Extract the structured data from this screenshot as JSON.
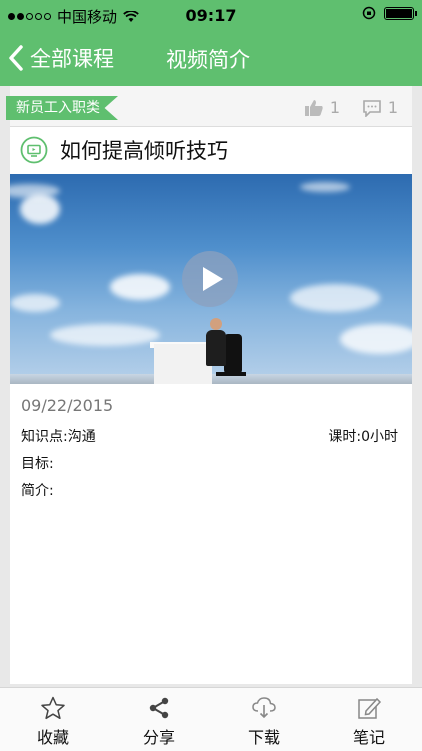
{
  "status_bar": {
    "carrier": "中国移动",
    "time": "09:17"
  },
  "nav": {
    "back_label": "全部课程",
    "title": "视频简介"
  },
  "course": {
    "category_tag": "新员工入职类",
    "like_count": "1",
    "comment_count": "1",
    "title": "如何提高倾听技巧",
    "date": "09/22/2015",
    "knowledge_point": "知识点:沟通",
    "hours": "课时:0小时",
    "goal": "目标:",
    "intro": "简介:"
  },
  "tabs": [
    {
      "label": "收藏",
      "icon": "star-icon"
    },
    {
      "label": "分享",
      "icon": "share-icon"
    },
    {
      "label": "下载",
      "icon": "cloud-download-icon"
    },
    {
      "label": "笔记",
      "icon": "note-edit-icon"
    }
  ],
  "colors": {
    "accent": "#5fbf6f",
    "background": "#e8e8e8"
  }
}
